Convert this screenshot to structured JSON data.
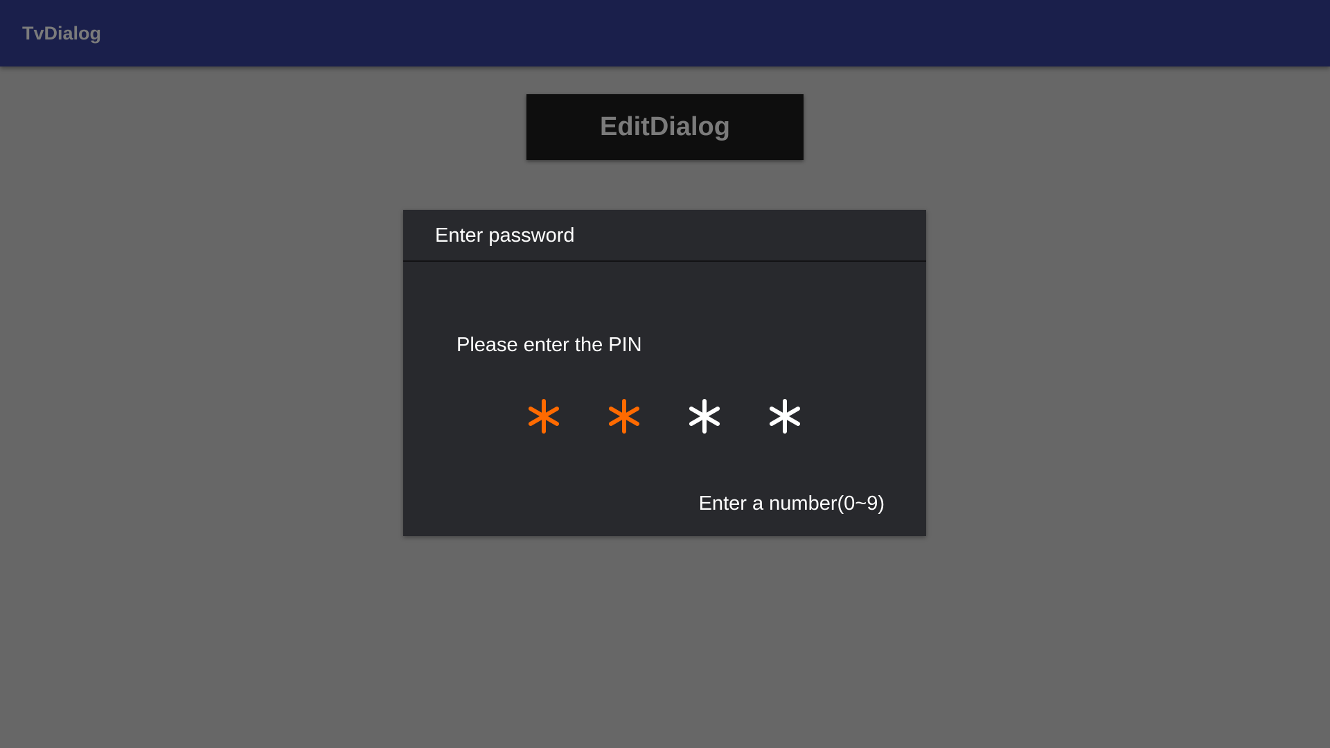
{
  "app": {
    "title": "TvDialog"
  },
  "main": {
    "edit_button_label": "EditDialog"
  },
  "dialog": {
    "title": "Enter password",
    "prompt": "Please enter the PIN",
    "hint": "Enter a number(0~9)",
    "pin": {
      "length": 4,
      "entered_count": 2,
      "mask_char": "*",
      "entered_color": "#ff6a00",
      "empty_color": "#ffffff",
      "digits": [
        {
          "icon": "asterisk-icon",
          "state": "entered"
        },
        {
          "icon": "asterisk-icon",
          "state": "entered"
        },
        {
          "icon": "asterisk-icon",
          "state": "empty"
        },
        {
          "icon": "asterisk-icon",
          "state": "empty"
        }
      ]
    }
  },
  "colors": {
    "appbar_bg": "#1a1f4b",
    "page_bg": "#676767",
    "dialog_bg": "#28292d",
    "accent": "#ff6a00"
  }
}
